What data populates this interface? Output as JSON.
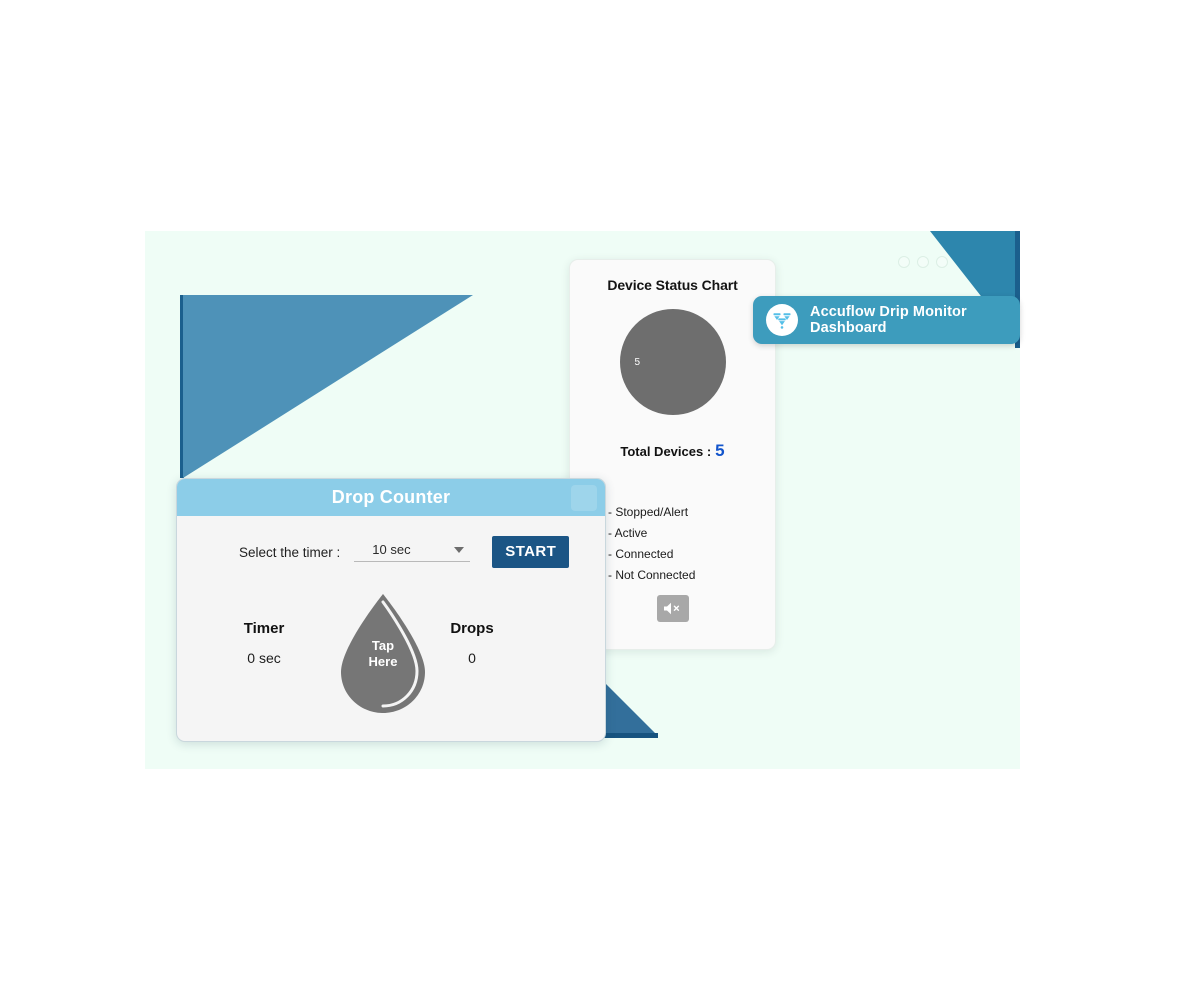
{
  "badge": {
    "title": "Accuflow Drip Monitor Dashboard",
    "logo_icon": "drip-funnel-logo-icon",
    "background_color": "#3d9cbd"
  },
  "window": {
    "dots": [
      "window-dot-1",
      "window-dot-2",
      "window-dot-3"
    ],
    "background_color": "#effdf6",
    "accent_color": "#4e92b8"
  },
  "status_card": {
    "title": "Device Status Chart",
    "donut_label": "5",
    "total_label": "Total Devices :",
    "total_value": "5",
    "total_value_color": "#1355cc",
    "mute_icon": "speaker-muted-icon",
    "legend": [
      {
        "label": "- Stopped/Alert",
        "color": "#d61313"
      },
      {
        "label": "- Active",
        "color": "#17921a"
      },
      {
        "label": "- Connected",
        "color": "#108ec9"
      },
      {
        "label": "- Not Connected",
        "color": "#6e6e6e"
      }
    ]
  },
  "drop_counter": {
    "header_title": "Drop Counter",
    "header_color": "#8ccde8",
    "timer_label": "Select the timer :",
    "timer_selected": "10 sec",
    "timer_options": [
      "10 sec"
    ],
    "start_label": "START",
    "start_color": "#1b5585",
    "droplet_line1": "Tap",
    "droplet_line2": "Here",
    "droplet_color": "#6e6e6e",
    "stats": [
      {
        "title": "Timer",
        "value": "0 sec"
      },
      {
        "title": "Drops",
        "value": "0"
      }
    ]
  },
  "chart_data": {
    "type": "pie",
    "title": "Device Status Chart",
    "categories": [
      "Stopped/Alert",
      "Active",
      "Connected",
      "Not Connected"
    ],
    "values": [
      0,
      0,
      0,
      5
    ],
    "colors": [
      "#d61313",
      "#17921a",
      "#108ec9",
      "#6e6e6e"
    ],
    "total": 5,
    "data_labels": [
      "5"
    ],
    "legend_position": "bottom-left",
    "grid": false
  }
}
